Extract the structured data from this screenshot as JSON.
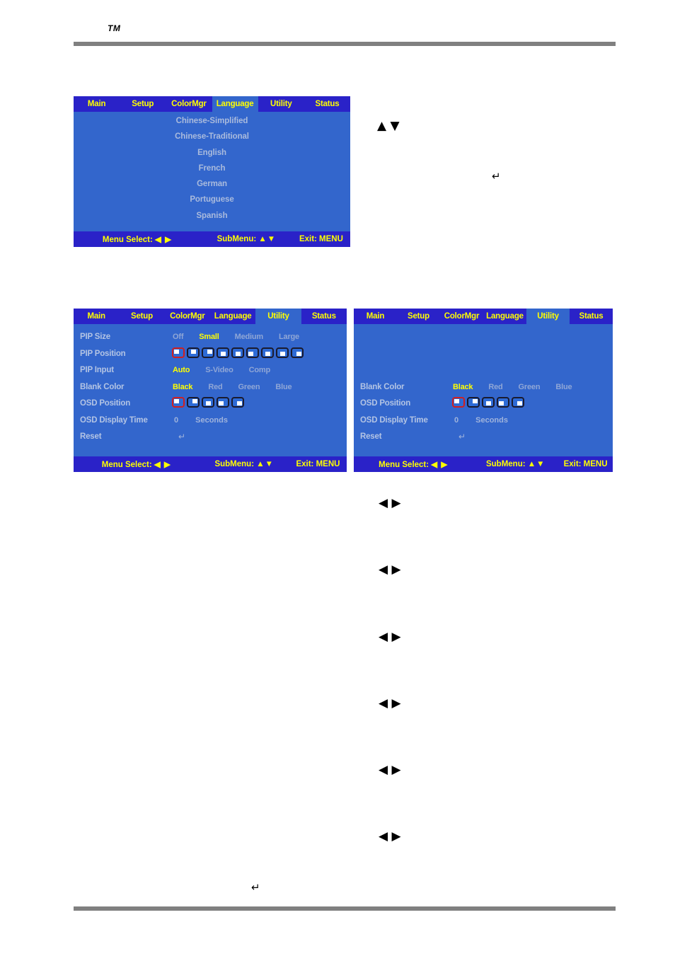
{
  "page": {
    "trademark": "TM"
  },
  "language_panel": {
    "tabs": [
      {
        "label": "Main",
        "active": false
      },
      {
        "label": "Setup",
        "active": false
      },
      {
        "label": "ColorMgr",
        "active": false
      },
      {
        "label": "Language",
        "active": true
      },
      {
        "label": "Utility",
        "active": false
      },
      {
        "label": "Status",
        "active": false
      }
    ],
    "items": [
      "Chinese-Simplified",
      "Chinese-Traditional",
      "English",
      "French",
      "German",
      "Portuguese",
      "Spanish"
    ],
    "footer": {
      "menu_select_label": "Menu Select:",
      "menu_select_arrows": "◀ ▶",
      "submenu_label": "SubMenu:",
      "submenu_arrows": "▲▼",
      "exit_label": "Exit:  MENU"
    }
  },
  "utility_panel_left": {
    "tabs": [
      {
        "label": "Main",
        "active": false
      },
      {
        "label": "Setup",
        "active": false
      },
      {
        "label": "ColorMgr",
        "active": false
      },
      {
        "label": "Language",
        "active": false
      },
      {
        "label": "Utility",
        "active": true
      },
      {
        "label": "Status",
        "active": false
      }
    ],
    "rows": {
      "pip_size": {
        "label": "PIP Size",
        "options": [
          "Off",
          "Small",
          "Medium",
          "Large"
        ],
        "selected": "Small"
      },
      "pip_position": {
        "label": "PIP Position",
        "chips": [
          "tl",
          "tc",
          "tr",
          "cc",
          "cc",
          "cl",
          "bc",
          "bc",
          "br"
        ],
        "selected_index": 0
      },
      "pip_input": {
        "label": "PIP Input",
        "options": [
          "Auto",
          "S-Video",
          "Comp"
        ],
        "selected": "Auto"
      },
      "blank_color": {
        "label": "Blank Color",
        "options": [
          "Black",
          "Red",
          "Green",
          "Blue"
        ],
        "selected": "Black"
      },
      "osd_position": {
        "label": "OSD Position",
        "chips": [
          "tl",
          "tr",
          "cc",
          "bl",
          "br"
        ],
        "selected_index": 0
      },
      "osd_display_time": {
        "label": "OSD Display Time",
        "value": "0",
        "unit": "Seconds"
      },
      "reset": {
        "label": "Reset",
        "glyph": "↵"
      }
    },
    "footer": {
      "menu_select_label": "Menu Select:",
      "menu_select_arrows": "◀ ▶",
      "submenu_label": "SubMenu:",
      "submenu_arrows": "▲▼",
      "exit_label": "Exit:  MENU"
    }
  },
  "utility_panel_right": {
    "tabs": [
      {
        "label": "Main",
        "active": false
      },
      {
        "label": "Setup",
        "active": false
      },
      {
        "label": "ColorMgr",
        "active": false
      },
      {
        "label": "Language",
        "active": false
      },
      {
        "label": "Utility",
        "active": true
      },
      {
        "label": "Status",
        "active": false
      }
    ],
    "rows": {
      "blank_color": {
        "label": "Blank Color",
        "options": [
          "Black",
          "Red",
          "Green",
          "Blue"
        ],
        "selected": "Black"
      },
      "osd_position": {
        "label": "OSD Position",
        "chips": [
          "tl",
          "tr",
          "cc",
          "bl",
          "br"
        ],
        "selected_index": 0
      },
      "osd_display_time": {
        "label": "OSD Display Time",
        "value": "0",
        "unit": "Seconds"
      },
      "reset": {
        "label": "Reset",
        "glyph": "↵"
      }
    },
    "footer": {
      "menu_select_label": "Menu Select:",
      "menu_select_arrows": "◀ ▶",
      "submenu_label": "SubMenu:",
      "submenu_arrows": "▲▼",
      "exit_label": "Exit:  MENU"
    }
  },
  "annotations": {
    "updown_arrows": "▲ ▼",
    "enter_arrow": "↵",
    "leftright_arrows": "◀ ▶"
  },
  "colors": {
    "osd_tabbar": "#2A22C8",
    "osd_body": "#3366CC",
    "osd_highlight_text": "#FFFF00",
    "osd_dim_text": "#AABBDD",
    "rule": "#808080",
    "chip_selected_border": "#D02020"
  }
}
